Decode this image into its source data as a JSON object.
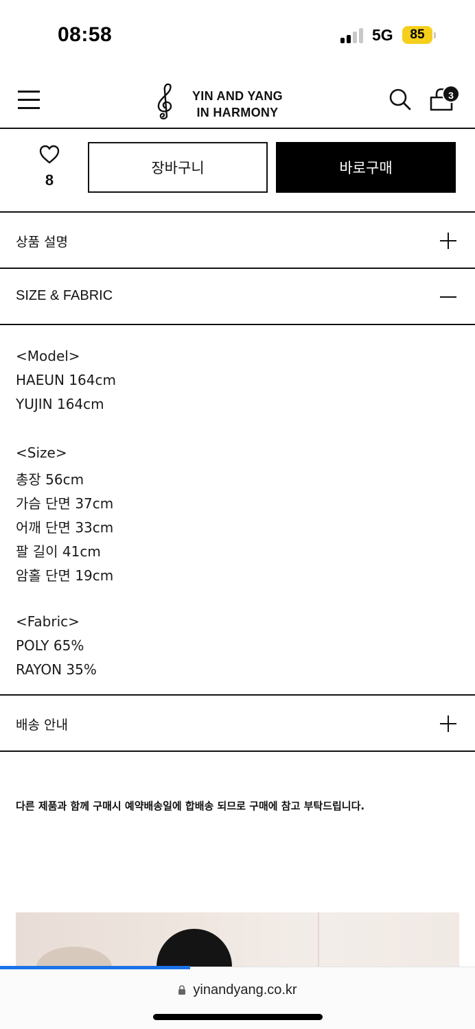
{
  "status_bar": {
    "time": "08:58",
    "network": "5G",
    "battery": "85",
    "battery_color": "#f5cf1b"
  },
  "header": {
    "menu_icon": "hamburger-menu-icon",
    "logo_icon": "treble-clef-icon",
    "logo_line1": "YIN AND YANG",
    "logo_line2": "IN HARMONY",
    "search_icon": "search-icon",
    "cart_icon": "shopping-bag-icon",
    "cart_count": "3"
  },
  "actions": {
    "like_icon": "heart-icon",
    "like_count": "8",
    "add_to_cart_label": "장바구니",
    "buy_now_label": "바로구매",
    "buy_now_color": "#000000"
  },
  "accordions": [
    {
      "title": "상품 설명",
      "state": "collapsed",
      "icon": "plus-icon"
    },
    {
      "title": "SIZE & FABRIC",
      "state": "expanded",
      "icon": "minus-icon"
    },
    {
      "title": "배송 안내",
      "state": "collapsed",
      "icon": "plus-icon"
    }
  ],
  "size_fabric": {
    "model_heading": "<Model>",
    "model_lines": [
      "HAEUN 164cm",
      "YUJIN 164cm"
    ],
    "size_heading": "<Size>",
    "size_lines": [
      "총장 56cm",
      "가슴 단면 37cm",
      "어깨 단면 33cm",
      "팔 길이 41cm",
      "암홀 단면 19cm"
    ],
    "fabric_heading": "<Fabric>",
    "fabric_lines": [
      "POLY 65%",
      "RAYON 35%"
    ]
  },
  "notice": "다른 제품과 함께 구매시 예약배송일에 합배송 되므로 구매에 참고 부탁드립니다.",
  "browser": {
    "lock_icon": "lock-icon",
    "url": "yinandyang.co.kr",
    "progress_fraction": 0.4,
    "progress_color": "#1c72e8"
  }
}
